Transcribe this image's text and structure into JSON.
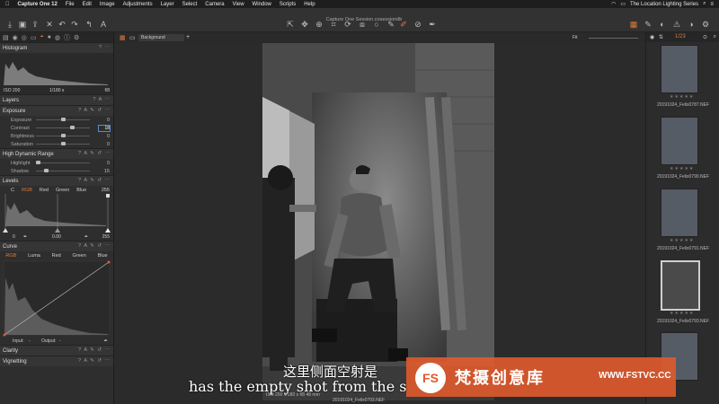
{
  "menubar": {
    "app": "Capture One 12",
    "items": [
      "File",
      "Edit",
      "Image",
      "Adjustments",
      "Layer",
      "Select",
      "Camera",
      "View",
      "Window",
      "Scripts",
      "Help"
    ],
    "right_title": "The Location Lighting Series"
  },
  "window": {
    "title": "Capture One Session.cosessiondb"
  },
  "viewer": {
    "variant": "Background",
    "fit": "Fit",
    "counter": "1/23"
  },
  "histogram": {
    "title": "Histogram",
    "iso": "ISO 200",
    "shutter": "1/180 s",
    "aperture": "f/8"
  },
  "layers": {
    "title": "Layers"
  },
  "exposure": {
    "title": "Exposure",
    "rows": [
      {
        "label": "Exposure",
        "value": "0"
      },
      {
        "label": "Contrast",
        "value": "18"
      },
      {
        "label": "Brightness",
        "value": "0"
      },
      {
        "label": "Saturation",
        "value": "0"
      }
    ]
  },
  "hdr": {
    "title": "High Dynamic Range",
    "rows": [
      {
        "label": "Highlight",
        "value": "0"
      },
      {
        "label": "Shadow",
        "value": "15"
      }
    ]
  },
  "levels": {
    "title": "Levels",
    "tabs": [
      "C",
      "RGB",
      "Red",
      "Green",
      "Blue"
    ],
    "top_value": "255",
    "bottom": {
      "left": "0",
      "mid": "0.00",
      "right": "255"
    }
  },
  "curve": {
    "title": "Curve",
    "tabs": [
      "RGB",
      "Luma",
      "Red",
      "Green",
      "Blue"
    ],
    "input_label": "Input:",
    "output_label": "Output:",
    "input_value": "-",
    "output_value": "-"
  },
  "clarity": {
    "title": "Clarity"
  },
  "vignetting": {
    "title": "Vignetting"
  },
  "browser": {
    "thumbs": [
      {
        "name": "20191024_Felix0787.NEF"
      },
      {
        "name": "20191024_Felix0790.NEF"
      },
      {
        "name": "20191024_Felix0791.NEF"
      },
      {
        "name": "20191024_Felix0793.NEF"
      }
    ]
  },
  "image_info": {
    "line1": "ISO 200   1/180 s   f/8   48 mm",
    "filename": "20191024_Felix0793.NEF"
  },
  "subtitles": {
    "cn": "这里侧面空射是",
    "en": "has the empty shot from the s"
  },
  "watermark": {
    "logo": "FS",
    "cn": "梵摄创意库",
    "url": "WWW.FSTVC.CC"
  },
  "colors": {
    "accent": "#e05a2c",
    "panel": "#2e2e2e",
    "selection": "#4d8fd6"
  }
}
